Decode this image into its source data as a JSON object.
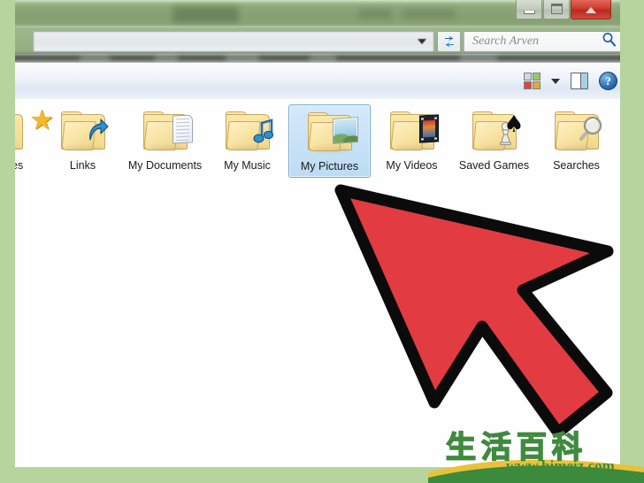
{
  "window": {
    "title": "",
    "controls": {
      "minimize_label": "Minimize",
      "maximize_label": "Maximize",
      "close_label": "Close",
      "close_color": "#cf3c2f"
    }
  },
  "address_bar": {
    "value": "",
    "dropdown_icon": "chevron-down-icon",
    "refresh_icon": "refresh-icon"
  },
  "search": {
    "placeholder": "Search Arven",
    "value": "",
    "icon": "search-icon"
  },
  "toolbar": {
    "items": [
      {
        "name": "views-icon",
        "label": "Views"
      },
      {
        "name": "views-dropdown-icon",
        "label": "Change your view"
      },
      {
        "name": "preview-pane-icon",
        "label": "Show the preview pane"
      },
      {
        "name": "help-icon",
        "label": "Get help",
        "glyph": "?"
      }
    ]
  },
  "files": [
    {
      "name": "Favorites",
      "label": "Favorites",
      "icon": "folder-favorites-icon",
      "selected": false,
      "clipped": true
    },
    {
      "name": "Links",
      "label": "Links",
      "icon": "folder-links-icon",
      "selected": false
    },
    {
      "name": "My Documents",
      "label": "My Documents",
      "icon": "folder-documents-icon",
      "selected": false
    },
    {
      "name": "My Music",
      "label": "My Music",
      "icon": "folder-music-icon",
      "selected": false
    },
    {
      "name": "My Pictures",
      "label": "My Pictures",
      "icon": "folder-pictures-icon",
      "selected": true
    },
    {
      "name": "My Videos",
      "label": "My Videos",
      "icon": "folder-videos-icon",
      "selected": false
    },
    {
      "name": "Saved Games",
      "label": "Saved Games",
      "icon": "folder-games-icon",
      "selected": false
    },
    {
      "name": "Searches",
      "label": "Searches",
      "icon": "folder-searches-icon",
      "selected": false
    }
  ],
  "cursor": {
    "type": "arrow-pointer",
    "color": "#e23b42",
    "outline": "#000000"
  },
  "watermark": {
    "cjk_text": "生活百科",
    "url": "www.bimeiz.com",
    "accent_green": "#3c8a3c",
    "accent_yellow": "#e8c23a"
  },
  "theme": {
    "page_border": "#b6d49c",
    "selection": "#bcdcf4",
    "folder": "#f3d98c"
  }
}
